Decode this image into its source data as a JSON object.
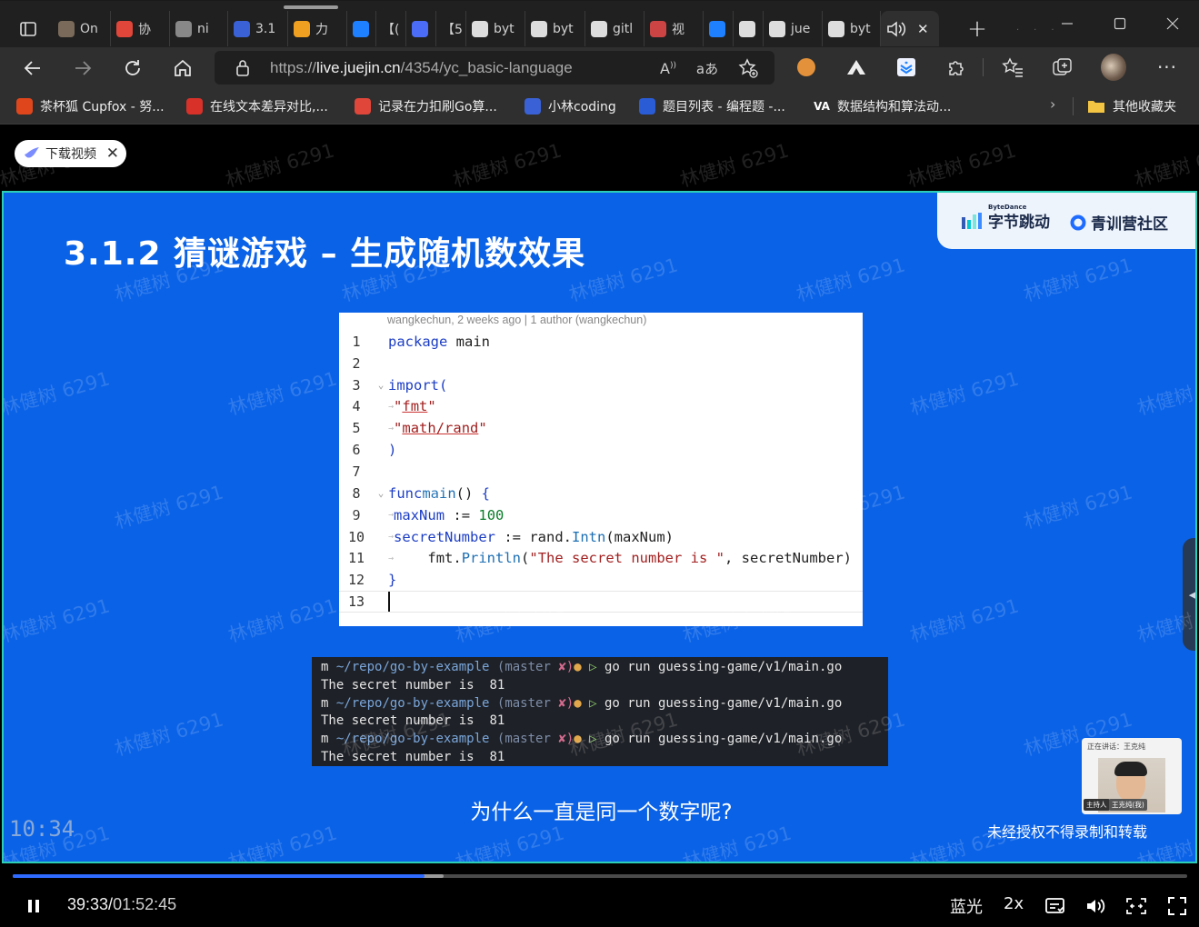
{
  "browser": {
    "tabs": [
      {
        "label": "On",
        "favicon": "user-avatar-icon",
        "color": "#7a6a5a"
      },
      {
        "label": "协",
        "favicon": "c-logo-icon",
        "color": "#e0463a"
      },
      {
        "label": "ni",
        "favicon": "triangle-logo-icon",
        "color": "#888888"
      },
      {
        "label": "3.1",
        "favicon": "bear-logo-icon",
        "color": "#3a62d6"
      },
      {
        "label": "力",
        "favicon": "leetcode-icon",
        "color": "#f0a020"
      },
      {
        "label": "",
        "favicon": "juejin-icon",
        "color": "#1e80ff"
      },
      {
        "label": "【(",
        "favicon": "",
        "color": "#202020"
      },
      {
        "label": "",
        "favicon": "doc-icon",
        "color": "#4a6cf7"
      },
      {
        "label": "【5",
        "favicon": "",
        "color": "#202020"
      },
      {
        "label": "byt",
        "favicon": "doc-circle-icon",
        "color": "#dddddd"
      },
      {
        "label": "byt",
        "favicon": "doc-circle-icon",
        "color": "#dddddd"
      },
      {
        "label": "gitl",
        "favicon": "doc-circle-icon",
        "color": "#dddddd"
      },
      {
        "label": "视",
        "favicon": "video-icon",
        "color": "#c44"
      },
      {
        "label": "",
        "favicon": "juejin-icon",
        "color": "#1e80ff"
      },
      {
        "label": "",
        "favicon": "book-icon",
        "color": "#dddddd"
      },
      {
        "label": "jue",
        "favicon": "doc-circle-icon",
        "color": "#dddddd"
      },
      {
        "label": "byt",
        "favicon": "doc-circle-icon",
        "color": "#dddddd"
      }
    ],
    "url_prefix": "https://",
    "url_host": "live.juejin.cn",
    "url_path": "/4354/yc_basic-language",
    "bookmarks": [
      {
        "label": "茶杯狐 Cupfox - 努...",
        "icon": "cupfox-icon",
        "color": "#e0461c"
      },
      {
        "label": "在线文本差异对比,...",
        "icon": "diff-icon",
        "color": "#d8312a"
      },
      {
        "label": "记录在力扣刷Go算...",
        "icon": "c-logo-icon",
        "color": "#e0463a"
      },
      {
        "label": "小林coding",
        "icon": "bear-logo-icon",
        "color": "#3a62d6"
      },
      {
        "label": "题目列表 - 编程题 -...",
        "icon": "nowcoder-icon",
        "color": "#2a5cd6"
      },
      {
        "label": "数据结构和算法动...",
        "icon": "va-icon",
        "color": "#ffffff"
      }
    ],
    "other_bookmarks": "其他收藏夹"
  },
  "page": {
    "download_label": "下载视频",
    "watermark_text": "林健树 6291"
  },
  "slide": {
    "title": "3.1.2 猜谜游戏 – 生成随机数效果",
    "brand_small": "ByteDance",
    "brand_name": "字节跳动",
    "community": "青训营社区",
    "code_meta": "wangkechun, 2 weeks ago | 1 author (wangkechun)",
    "terminal": {
      "prompt_m": "m",
      "path": "~/repo/go-by-example",
      "branch": "(master",
      "dirty": "✘)",
      "dot": "●",
      "arrow": "▷",
      "command": "go run guessing-game/v1/main.go",
      "output_label": "The secret number is",
      "output_value": "81"
    },
    "subtitle": "为什么一直是同一个数字呢?",
    "timecode": "10:34",
    "no_record_notice": "未经授权不得录制和转载",
    "speaker_status": "正在讲话：王克纯",
    "speaker_role": "主持人",
    "speaker_name": "王克纯(我)"
  },
  "player": {
    "current_time": "39:33",
    "separator": "/",
    "duration": "01:52:45",
    "progress_fraction": 0.351,
    "buffered_fraction": 0.367,
    "quality_label": "蓝光",
    "speed_label": "2x"
  }
}
